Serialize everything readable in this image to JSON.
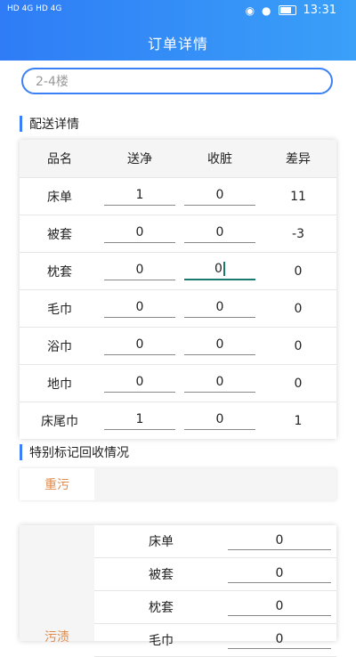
{
  "status_bar": {
    "left_text": "HD 4G HD 4G",
    "time": "13:31"
  },
  "header": {
    "title": "订单详情"
  },
  "search": {
    "placeholder": "2-4楼"
  },
  "delivery": {
    "section_title": "配送详情",
    "columns": [
      "品名",
      "送净",
      "收脏",
      "差异"
    ],
    "rows": [
      {
        "name": "床单",
        "clean": "1",
        "dirty": "0",
        "diff": "11"
      },
      {
        "name": "被套",
        "clean": "0",
        "dirty": "0",
        "diff": "-3"
      },
      {
        "name": "枕套",
        "clean": "0",
        "dirty": "0",
        "diff": "0"
      },
      {
        "name": "毛巾",
        "clean": "0",
        "dirty": "0",
        "diff": "0"
      },
      {
        "name": "浴巾",
        "clean": "0",
        "dirty": "0",
        "diff": "0"
      },
      {
        "name": "地巾",
        "clean": "0",
        "dirty": "0",
        "diff": "0"
      },
      {
        "name": "床尾巾",
        "clean": "1",
        "dirty": "0",
        "diff": "1"
      }
    ]
  },
  "special": {
    "section_title": "特别标记回收情况",
    "tab_label": "重污",
    "group_label": "污渍",
    "items": [
      {
        "name": "床单",
        "value": "0"
      },
      {
        "name": "被套",
        "value": "0"
      },
      {
        "name": "枕套",
        "value": "0"
      },
      {
        "name": "毛巾",
        "value": "0"
      }
    ]
  }
}
